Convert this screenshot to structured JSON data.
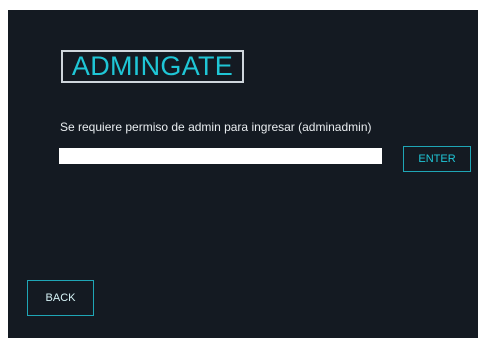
{
  "app": {
    "logo_text": "ADMINGATE"
  },
  "form": {
    "prompt": "Se requiere permiso de admin para ingresar (adminadmin)",
    "password_value": "",
    "enter_label": "ENTER"
  },
  "nav": {
    "back_label": "BACK"
  },
  "colors": {
    "background": "#141a22",
    "accent": "#1fc6d6",
    "button_border": "#1fa6b6",
    "logo_border": "#cfd6dc",
    "text": "#e8ecef"
  }
}
